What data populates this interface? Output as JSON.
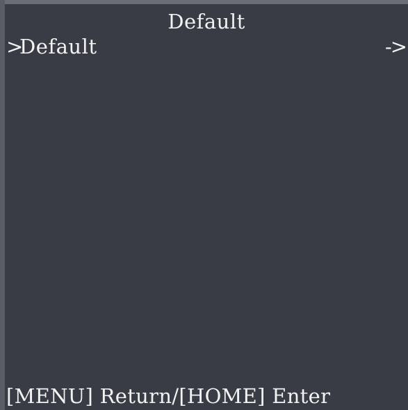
{
  "screen": {
    "title": "Default",
    "menu": {
      "items": [
        {
          "cursor": ">",
          "label": "Default",
          "arrow": "->"
        }
      ]
    },
    "footer": {
      "hint": "[MENU] Return/[HOME] Enter"
    }
  },
  "colors": {
    "background": "#393c45",
    "text": "#f2f2f2"
  }
}
